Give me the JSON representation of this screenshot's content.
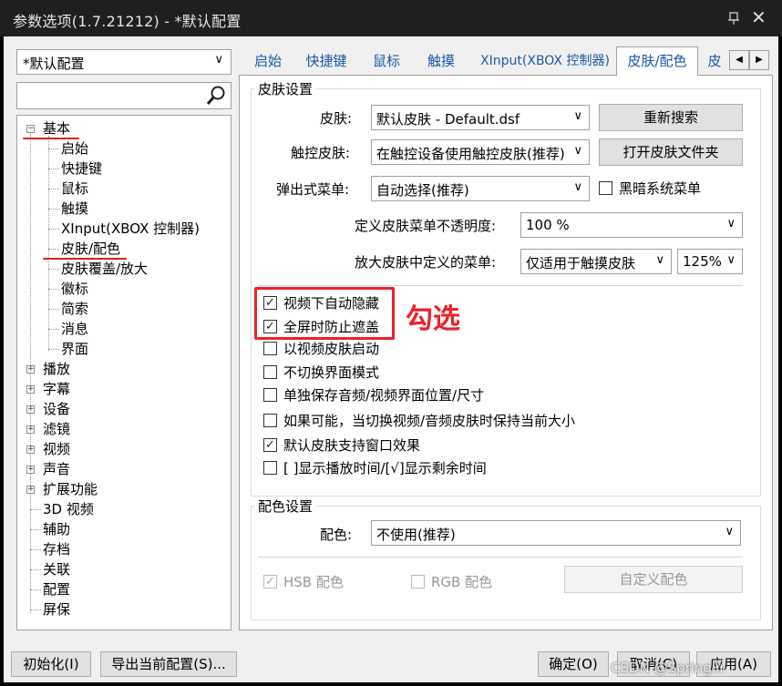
{
  "window": {
    "title": "参数选项(1.7.21212) - *默认配置"
  },
  "left": {
    "profile": "*默认配置",
    "search_placeholder": "",
    "tree": {
      "basic": "基本",
      "basic_children": [
        "启始",
        "快捷键",
        "鼠标",
        "触摸",
        "XInput(XBOX 控制器)",
        "皮肤/配色",
        "皮肤覆盖/放大",
        "徽标",
        "简索",
        "消息",
        "界面"
      ],
      "expandable": [
        "播放",
        "字幕",
        "设备",
        "滤镜",
        "视频",
        "声音",
        "扩展功能"
      ],
      "leaves": [
        "3D 视频",
        "辅助",
        "存档",
        "关联",
        "配置",
        "屏保"
      ]
    }
  },
  "tabs": [
    "启始",
    "快捷键",
    "鼠标",
    "触摸",
    "XInput(XBOX 控制器)",
    "皮肤/配色",
    "皮"
  ],
  "skin": {
    "group_title": "皮肤设置",
    "skin_label": "皮肤:",
    "skin_value": "默认皮肤 - Default.dsf",
    "rescan_button": "重新搜索",
    "touch_label": "触控皮肤:",
    "touch_value": "在触控设备使用触控皮肤(推荐)",
    "open_folder_button": "打开皮肤文件夹",
    "popup_label": "弹出式菜单:",
    "popup_value": "自动选择(推荐)",
    "dark_menu_label": "黑暗系统菜单",
    "opacity_label": "定义皮肤菜单不透明度:",
    "opacity_value": "100 %",
    "zoom_label": "放大皮肤中定义的菜单:",
    "zoom_value": "仅适用于触摸皮肤",
    "zoom_percent": "125%",
    "checkboxes": [
      {
        "label": "视频下自动隐藏",
        "checked": true
      },
      {
        "label": "全屏时防止遮盖",
        "checked": true
      },
      {
        "label": "以视频皮肤启动",
        "checked": false
      },
      {
        "label": "不切换界面模式",
        "checked": false
      },
      {
        "label": "单独保存音频/视频界面位置/尺寸",
        "checked": false
      },
      {
        "label": "如果可能，当切换视频/音频皮肤时保持当前大小",
        "checked": false
      },
      {
        "label": "默认皮肤支持窗口效果",
        "checked": true
      },
      {
        "label": "[ ]显示播放时间/[√]显示剩余时间",
        "checked": false
      }
    ]
  },
  "color": {
    "group_title": "配色设置",
    "color_label": "配色:",
    "color_value": "不使用(推荐)",
    "hsb_label": "HSB 配色",
    "hsb_checked": true,
    "rgb_label": "RGB 配色",
    "rgb_checked": false,
    "custom_button": "自定义配色"
  },
  "annotation": {
    "text": "勾选",
    "color": "#e8232a"
  },
  "bottom": {
    "init_button": "初始化(I)",
    "export_button": "导出当前配置(S)...",
    "ok_button": "确定(O)",
    "cancel_button": "取消(C)",
    "apply_button": "应用(A)",
    "watermark": "CSDN @Springlir"
  }
}
